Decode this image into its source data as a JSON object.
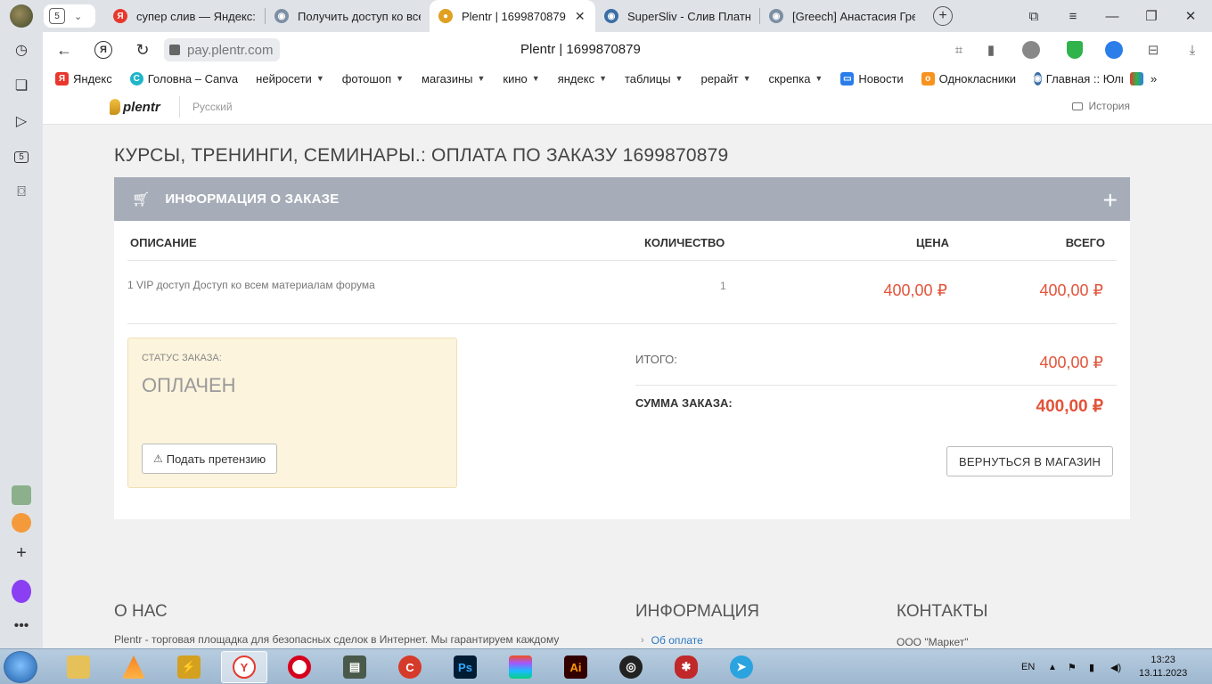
{
  "browser": {
    "tab_group_count": "5",
    "tabs": [
      {
        "title": "супер слив — Яндекс: а",
        "favicon": "yandex-icon",
        "color": "#e8382d",
        "active": false
      },
      {
        "title": "Получить доступ ко все",
        "favicon": "globe-icon",
        "color": "#7c8fa3",
        "active": false
      },
      {
        "title": "Plentr | 1699870879",
        "favicon": "plentr-icon",
        "color": "#e0a020",
        "active": true,
        "close": "✕"
      },
      {
        "title": "SuperSliv - Слив Платнь",
        "favicon": "globe-icon",
        "color": "#3a6ea5",
        "active": false
      },
      {
        "title": "[Greech] Анастасия Греч",
        "favicon": "globe-icon",
        "color": "#7c8fa3",
        "active": false
      }
    ],
    "address": {
      "host": "pay.plentr.com",
      "page_title": "Plentr | 1699870879"
    },
    "bookmarks": [
      {
        "label": "Яндекс",
        "icon": "yandex-icon",
        "color": "#e8382d",
        "dropdown": false
      },
      {
        "label": "Головна – Canva",
        "icon": "canva-icon",
        "color": "#1fb6c9",
        "dropdown": false
      },
      {
        "label": "нейросети",
        "dropdown": true
      },
      {
        "label": "фотошоп",
        "dropdown": true
      },
      {
        "label": "магазины",
        "dropdown": true
      },
      {
        "label": "кино",
        "dropdown": true
      },
      {
        "label": "яндекс",
        "dropdown": true
      },
      {
        "label": "таблицы",
        "dropdown": true
      },
      {
        "label": "рерайт",
        "dropdown": true
      },
      {
        "label": "скрепка",
        "dropdown": true
      },
      {
        "label": "Новости",
        "icon": "news-icon",
        "color": "#2b7de9",
        "dropdown": false
      },
      {
        "label": "Однокласники",
        "icon": "ok-icon",
        "color": "#f7931e",
        "dropdown": false
      },
      {
        "label": "Главная :: Юли",
        "icon": "site-icon",
        "color": "#3a6ea5",
        "dropdown": false
      }
    ]
  },
  "site": {
    "logo_text": "plentr",
    "language": "Русский",
    "history_link": "История",
    "order_heading": "КУРСЫ, ТРЕНИНГИ, СЕМИНАРЫ.: ОПЛАТА ПО ЗАКАЗУ 1699870879",
    "order_info": {
      "title": "ИНФОРМАЦИЯ О ЗАКАЗЕ",
      "columns": {
        "description": "ОПИСАНИЕ",
        "quantity": "КОЛИЧЕСТВО",
        "price": "ЦЕНА",
        "total": "ВСЕГО"
      },
      "items": [
        {
          "description": "1 VIP доступ Доступ ко всем материалам форума",
          "quantity": "1",
          "price": "400,00 ₽",
          "total": "400,00 ₽"
        }
      ]
    },
    "status": {
      "label": "СТАТУС ЗАКАЗА:",
      "value": "ОПЛАЧЕН",
      "claim_button": "Подать претензию"
    },
    "summary": {
      "subtotal_label": "ИТОГО:",
      "subtotal_value": "400,00 ₽",
      "total_label": "СУММА ЗАКАЗА:",
      "total_value": "400,00 ₽",
      "return_button": "ВЕРНУТЬСЯ В МАГАЗИН"
    },
    "footer": {
      "about_title": "О НАС",
      "about_text": "Plentr - торговая площадка для безопасных сделок в Интернет. Мы гарантируем каждому",
      "info_title": "ИНФОРМАЦИЯ",
      "info_link": "Об оплате",
      "contacts_title": "КОНТАКТЫ",
      "contacts_company": "ООО \"Маркет\""
    }
  },
  "taskbar": {
    "language": "EN",
    "time": "13:23",
    "date": "13.11.2023"
  },
  "colors": {
    "accent_price": "#e2543a",
    "card_header": "#a6adb8",
    "status_box": "#fcf4dd"
  }
}
